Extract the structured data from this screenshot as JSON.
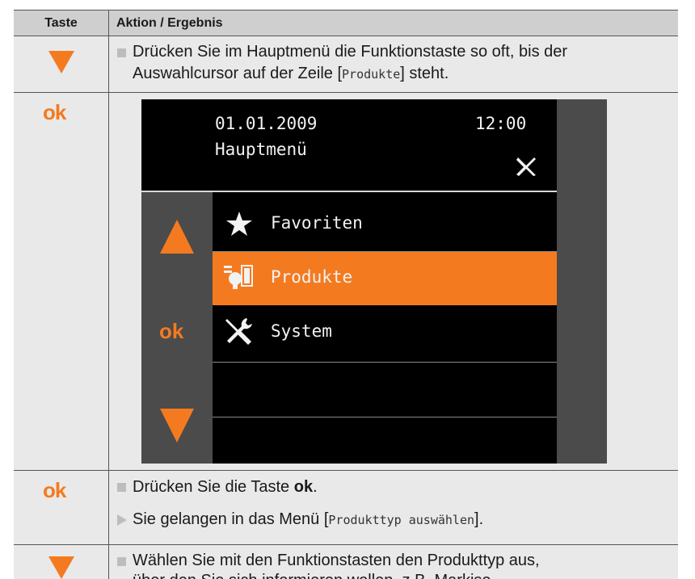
{
  "table": {
    "header": {
      "key": "Taste",
      "action": "Aktion / Ergebnis"
    },
    "row1": {
      "key_icon": "arrow-down-key-icon",
      "text_line1": "Drücken Sie im Hauptmenü die Funktionstaste so oft, bis der",
      "text_line2_pre": "Auswahlcursor auf der Zeile [",
      "text_line2_code": "Produkte",
      "text_line2_post": "] steht."
    },
    "row2": {
      "key_label": "ok"
    },
    "row3": {
      "key_label": "ok",
      "step_pre": "Drücken Sie die Taste ",
      "step_bold": "ok",
      "step_post": ".",
      "result_pre": "Sie gelangen in das Menü [",
      "result_code": "Produkttyp auswählen",
      "result_post": "]."
    },
    "row4": {
      "key_icon": "arrow-down-key-icon",
      "text_line1": "Wählen Sie mit den Funktionstasten den Produkttyp aus,",
      "text_line2": "über den Sie sich informieren wollen, z.B. Markise"
    }
  },
  "device": {
    "date": "01.01.2009",
    "time": "12:00",
    "menu_title": "Hauptmenü",
    "ok_label": "ok",
    "items": [
      {
        "label": "Favoriten",
        "icon": "star-icon",
        "selected": false
      },
      {
        "label": "Produkte",
        "icon": "products-icon",
        "selected": true
      },
      {
        "label": "System",
        "icon": "tools-icon",
        "selected": false
      }
    ]
  },
  "colors": {
    "accent": "#f47a20",
    "cell": "#e9e9e9",
    "header": "#cfcfcf",
    "screen_bg": "#000000",
    "screen_side": "#4b4b4b"
  }
}
